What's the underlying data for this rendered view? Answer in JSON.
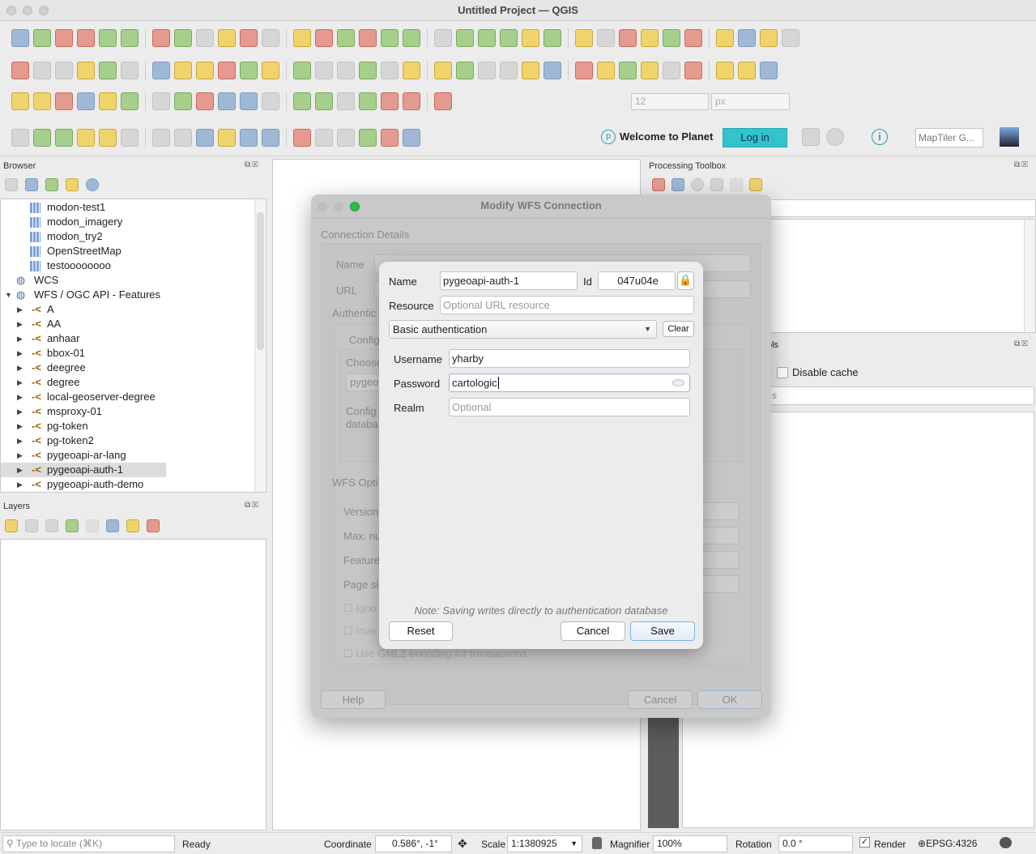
{
  "window": {
    "title": "Untitled Project — QGIS"
  },
  "toolbars": {
    "row1": [
      "new-project-icon",
      "open-project-icon",
      "save-project-icon",
      "new-print-layout-icon",
      "layout-manager-icon",
      "style-manager-icon",
      "pan-icon",
      "pan-to-selection-icon",
      "zoom-in-icon",
      "zoom-out-icon",
      "zoom-full-icon",
      "zoom-selection-icon",
      "zoom-layer-icon",
      "zoom-native-icon",
      "zoom-last-icon",
      "zoom-next-icon",
      "new-map-view-icon",
      "new-3d-view-icon",
      "new-bookmark-icon",
      "show-bookmarks-icon",
      "temporal-icon",
      "refresh-icon",
      "select-features-icon",
      "select-by-value-icon",
      "deselect-icon",
      "select-location-icon",
      "identify-icon",
      "attribute-table-icon",
      "processing-icon",
      "statistics-icon",
      "measure-icon",
      "ruler-icon",
      "annotation-icon",
      "locator-icon"
    ],
    "row2": [
      "data-source-manager-icon",
      "new-geopackage-icon",
      "new-shapefile-icon",
      "new-spatialite-icon",
      "new-temp-layer-icon",
      "add-raster-icon",
      "add-vector-icon",
      "edits-icon",
      "toggle-editing-icon",
      "save-edits-icon",
      "digitize-icon",
      "vertex-tool-icon",
      "add-feature-icon",
      "modify-attributes-icon",
      "delete-icon",
      "cut-icon",
      "copy-icon",
      "paste-icon",
      "undo-icon",
      "redo-icon",
      "label-icon",
      "label-pin-icon",
      "label-highlight-icon",
      "label-abc-red-icon",
      "label-move-icon",
      "label-rotate-icon",
      "label-change-icon",
      "label-show-icon",
      "label-icon-2",
      "metasearch-icon",
      "metasearch-2-icon",
      "python-icon",
      "help-icon"
    ],
    "row3": [
      "advanced-digitize-icon",
      "rotate-icon",
      "offset-curve-icon",
      "simplify-icon",
      "add-ring-icon",
      "add-part-icon",
      "fill-ring-icon",
      "delete-ring-icon",
      "delete-part-icon",
      "reshape-icon",
      "offset-icon",
      "split-features-icon",
      "split-parts-icon",
      "merge-icon",
      "merge-attributes-icon",
      "rotate-symbol-icon",
      "snapping-icon",
      "tracing-icon",
      "vertex-icon"
    ],
    "row3_fields": {
      "tolerance": "12",
      "unit": "px"
    },
    "row4": [
      "label-tool-icon",
      "select-label-icon",
      "add-polygon-icon",
      "add-point-icon",
      "favorite-icon",
      "text-annotation-icon",
      "node-icon",
      "text-dropdown-icon",
      "locator-green-icon",
      "georeferencer-icon",
      "planet-flag-icon",
      "globe-icon",
      "globe-2-icon",
      "globe-3-icon",
      "search-icon",
      "map-icon",
      "pin-icon",
      "satellite-icon"
    ],
    "planet": {
      "welcome": "Welcome to Planet",
      "login": "Log in"
    },
    "maptiler": {
      "placeholder": "MapTiler G..."
    }
  },
  "browser": {
    "title": "Browser",
    "items": [
      {
        "label": "modon-test1",
        "type": "xyz"
      },
      {
        "label": "modon_imagery",
        "type": "xyz"
      },
      {
        "label": "modon_try2",
        "type": "xyz"
      },
      {
        "label": "OpenStreetMap",
        "type": "xyz"
      },
      {
        "label": "testoooooooo",
        "type": "xyz"
      },
      {
        "label": "WCS",
        "type": "wcs"
      },
      {
        "label": "WFS / OGC API - Features",
        "type": "wfs-root"
      },
      {
        "label": "A",
        "type": "wfs"
      },
      {
        "label": "AA",
        "type": "wfs"
      },
      {
        "label": "anhaar",
        "type": "wfs"
      },
      {
        "label": "bbox-01",
        "type": "wfs"
      },
      {
        "label": "deegree",
        "type": "wfs"
      },
      {
        "label": "degree",
        "type": "wfs"
      },
      {
        "label": "local-geoserver-degree",
        "type": "wfs"
      },
      {
        "label": "msproxy-01",
        "type": "wfs"
      },
      {
        "label": "pg-token",
        "type": "wfs"
      },
      {
        "label": "pg-token2",
        "type": "wfs"
      },
      {
        "label": "pygeoapi-ar-lang",
        "type": "wfs"
      },
      {
        "label": "pygeoapi-auth-1",
        "type": "wfs",
        "selected": true
      },
      {
        "label": "pygeoapi-auth-demo",
        "type": "wfs"
      }
    ]
  },
  "layers": {
    "title": "Layers"
  },
  "processing": {
    "title": "Processing Toolbox"
  },
  "lower_right": {
    "title_fragment": "ols",
    "disable_cache": "Disable cache",
    "input_fragment": "s"
  },
  "wfs_dialog": {
    "title": "Modify WFS Connection",
    "connection_details": "Connection Details",
    "name_label": "Name",
    "url_label": "URL",
    "auth_label": "Authentic",
    "config_label": "Config",
    "choose_label": "Choose",
    "config_value": "pygeo",
    "config_db": "Config",
    "database": "databa",
    "wfs_options": "WFS Opti",
    "version": "Version",
    "max": "Max. nu",
    "features": "Feature",
    "page": "Page si",
    "ignore": "Igno",
    "invert": "Inve",
    "gml2": "Use GML2 encoding for transactions",
    "help": "Help",
    "cancel": "Cancel",
    "ok": "OK"
  },
  "auth_dialog": {
    "name_label": "Name",
    "name_value": "pygeoapi-auth-1",
    "id_label": "Id",
    "id_value": "047u04e",
    "resource_label": "Resource",
    "resource_placeholder": "Optional URL resource",
    "method": "Basic authentication",
    "clear": "Clear",
    "username_label": "Username",
    "username_value": "yharby",
    "password_label": "Password",
    "password_value": "cartologic",
    "realm_label": "Realm",
    "realm_placeholder": "Optional",
    "note": "Note: Saving writes directly to authentication database",
    "reset": "Reset",
    "cancel": "Cancel",
    "save": "Save"
  },
  "statusbar": {
    "locate_placeholder": "Type to locate (⌘K)",
    "status": "Ready",
    "coordinate_label": "Coordinate",
    "coordinate": "0.586°, -1°",
    "scale_label": "Scale",
    "scale": "1:1380925",
    "magnifier_label": "Magnifier",
    "magnifier": "100%",
    "rotation_label": "Rotation",
    "rotation": "0.0 °",
    "render_label": "Render",
    "render_checked": true,
    "crs": "EPSG:4326"
  },
  "colors": {
    "planet_login": "#33c3cc",
    "accent": "#3d8ee8"
  }
}
